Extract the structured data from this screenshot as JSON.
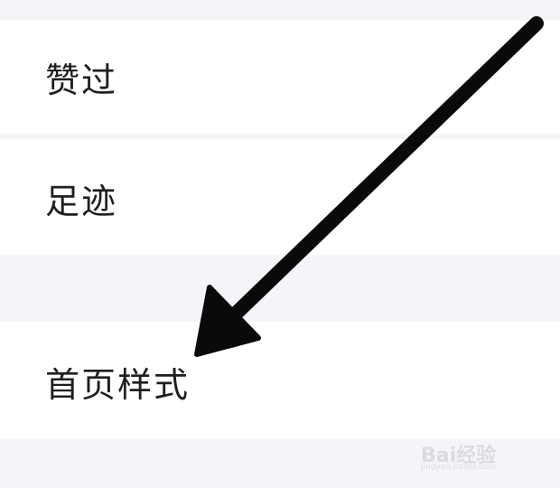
{
  "settings_list": {
    "items": [
      {
        "label": "赞过"
      },
      {
        "label": "足迹"
      },
      {
        "label": "首页样式"
      }
    ]
  },
  "annotation": {
    "arrow_color": "#0a0a0a",
    "points_to": "首页样式"
  },
  "watermark": {
    "brand": "Bai经验",
    "sub": "jingyan.baidu.com"
  }
}
